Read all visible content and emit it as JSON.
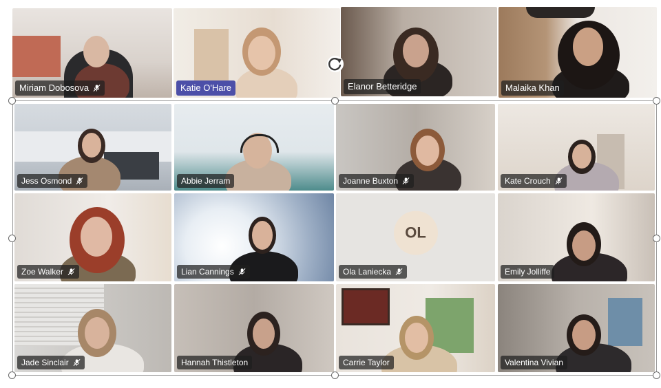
{
  "top_row": [
    {
      "name": "Miriam Dobosova",
      "muted": true,
      "active": false
    },
    {
      "name": "Katie O'Hare",
      "muted": false,
      "active": true
    },
    {
      "name": "Elanor Betteridge",
      "muted": false,
      "active": false
    },
    {
      "name": "Malaika Khan",
      "muted": false,
      "active": false
    }
  ],
  "grid": [
    {
      "name": "Jess Osmond",
      "muted": true
    },
    {
      "name": "Abbie Jerram",
      "muted": false
    },
    {
      "name": "Joanne Buxton",
      "muted": true
    },
    {
      "name": "Kate Crouch",
      "muted": true
    },
    {
      "name": "Zoe Walker",
      "muted": true
    },
    {
      "name": "Lian Cannings",
      "muted": true
    },
    {
      "name": "Ola Laniecka",
      "muted": true,
      "initials": "OL"
    },
    {
      "name": "Emily Jolliffe",
      "muted": false
    },
    {
      "name": "Jade Sinclair",
      "muted": true
    },
    {
      "name": "Hannah Thistleton",
      "muted": false
    },
    {
      "name": "Carrie Taylor",
      "muted": false
    },
    {
      "name": "Valentina Vivian",
      "muted": false
    }
  ],
  "icons": {
    "mute": "mic-off-icon",
    "rotate": "rotate-icon"
  }
}
